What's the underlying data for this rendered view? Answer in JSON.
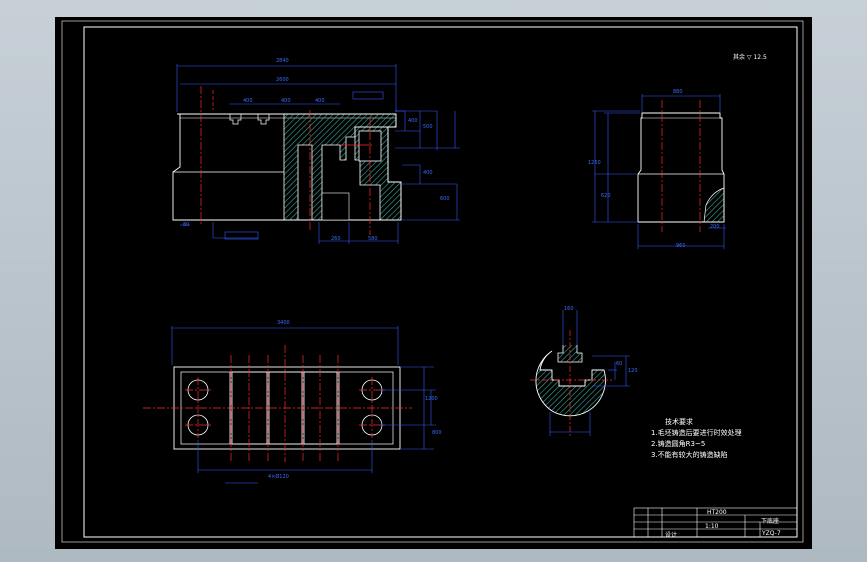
{
  "colors": {
    "background": "#000000",
    "outline": "#ffffff",
    "dimension": "#2f5bff",
    "centerline": "#ff2a2a",
    "hatch": "#3fa79b"
  },
  "tech_notes": {
    "title": "技术要求",
    "items": [
      "1.毛坯铸造后要进行时效处理",
      "2.铸造圆角R3~5",
      "3.不能有较大的铸造缺陷"
    ]
  },
  "title_block": {
    "material": "HT200",
    "part_name": "下底座",
    "scale": "1:10",
    "drawing_no": "YZQ-7",
    "left_label": "设计"
  },
  "scale_note": "其余 ▽ 12.5",
  "dimensions": {
    "front_total": "2840",
    "front_inner": "2600",
    "front_slot1": "400",
    "front_slot2": "400",
    "front_slot3": "400",
    "front_h1": "400",
    "front_h2": "500",
    "front_h3": "400",
    "front_h4": "600",
    "front_bottom1": "260",
    "front_bottom2": "580",
    "front_left": "80",
    "side_top": "880",
    "side_total_h": "1250",
    "side_bottom": "960",
    "side_right": "200",
    "side_h": "620",
    "plan_total": "3400",
    "plan_bottom": "4×Ø120",
    "plan_right1": "1200",
    "plan_right2": "800",
    "tslot_w": "160",
    "tslot_h1": "60",
    "tslot_h2": "120"
  }
}
